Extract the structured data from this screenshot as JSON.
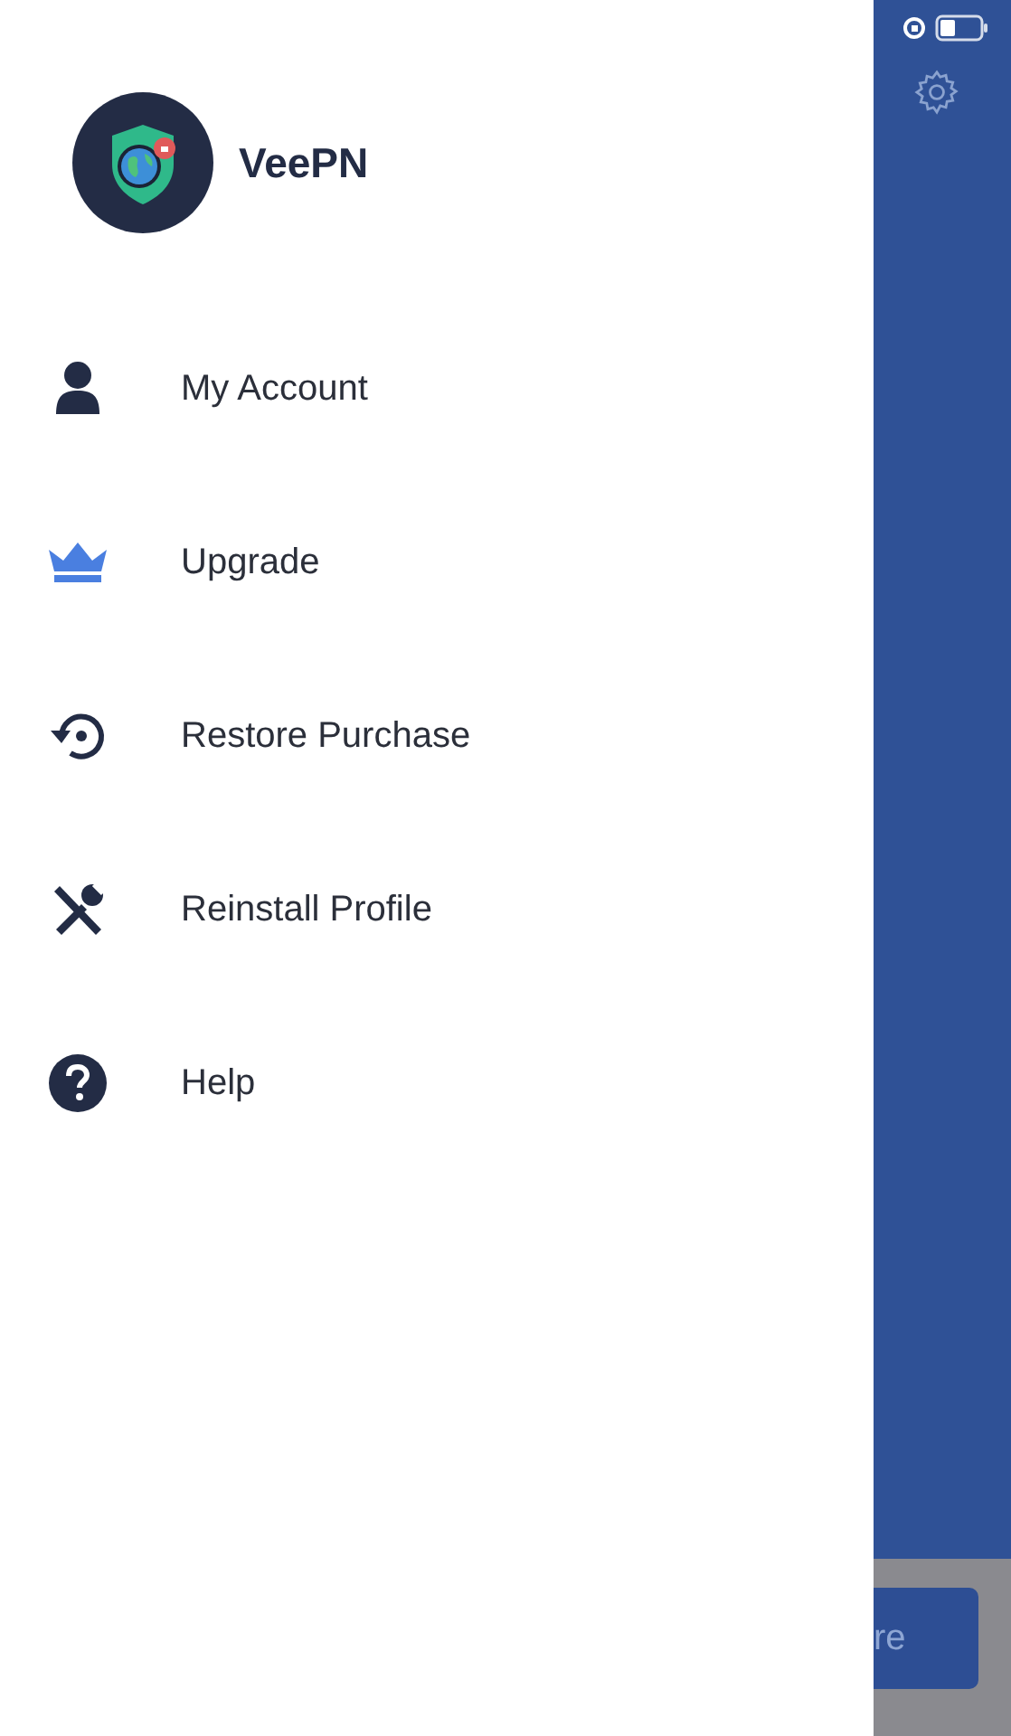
{
  "app": {
    "name": "VeePN"
  },
  "menu": [
    {
      "kind": "account",
      "label": "My Account"
    },
    {
      "kind": "upgrade",
      "label": "Upgrade"
    },
    {
      "kind": "restore",
      "label": "Restore Purchase"
    },
    {
      "kind": "reinstall",
      "label": "Reinstall Profile"
    },
    {
      "kind": "help",
      "label": "Help"
    }
  ],
  "background": {
    "button_label": "re"
  }
}
